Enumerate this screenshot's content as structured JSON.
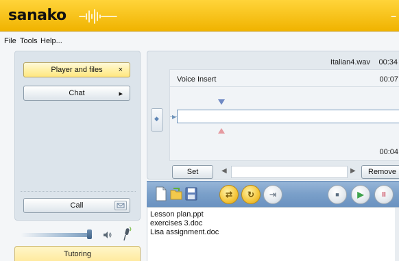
{
  "app": {
    "logo": "sanako",
    "minimize_glyph": "–"
  },
  "menu": {
    "items": [
      "File",
      "Tools",
      "Help..."
    ]
  },
  "sidebar": {
    "player_files_label": "Player and files",
    "player_files_close": "×",
    "chat_label": "Chat",
    "chat_arrow": "▸",
    "call_label": "Call",
    "tutoring_label": "Tutoring",
    "volume_level": 0.95
  },
  "player": {
    "filename": "Italian4.wav",
    "duration": "00:34",
    "voice_insert_label": "Voice Insert",
    "voice_insert_time": "00:07",
    "bottom_time": "00:04",
    "set_label": "Set",
    "remove_label": "Remove",
    "scroll_left_glyph": "◀",
    "scroll_right_glyph": "▶",
    "side_handle_glyph": "◆",
    "track_arrow_glyph": "▶"
  },
  "toolbar": {
    "icons": [
      "new-document-icon",
      "open-folder-icon",
      "save-disk-icon",
      "insert-icon",
      "loop-icon",
      "export-icon",
      "stop-icon",
      "play-icon",
      "pause-icon"
    ],
    "stop_glyph": "■",
    "play_glyph": "▶",
    "pause_glyph": "II",
    "insert_glyph": "⇄",
    "loop_glyph": "↻",
    "export_glyph": "⇥"
  },
  "files": [
    "Lesson plan.ppt",
    "exercises 3.doc",
    "Lisa assignment.doc"
  ],
  "colors": {
    "accent_yellow": "#f7c21a",
    "toolbar_blue": "#7a9fc9",
    "panel_bg": "#dce4eb"
  }
}
